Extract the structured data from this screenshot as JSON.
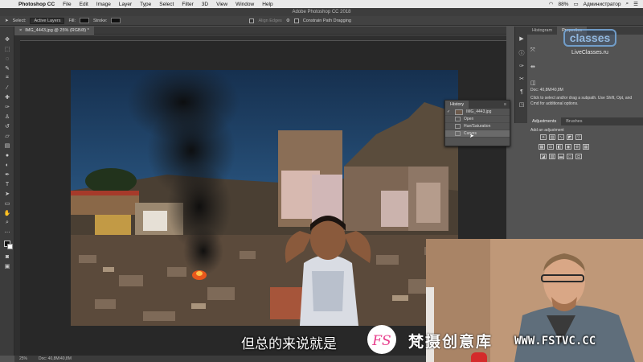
{
  "menubar": {
    "app": "Photoshop CC",
    "items": [
      "File",
      "Edit",
      "Image",
      "Layer",
      "Type",
      "Select",
      "Filter",
      "3D",
      "View",
      "Window",
      "Help"
    ],
    "battery": "88%",
    "user": "Администратор"
  },
  "window_title": "Adobe Photoshop CC 2018",
  "options": {
    "select_label": "Select:",
    "select_value": "Active Layers",
    "fill_label": "Fill:",
    "stroke_label": "Stroke:",
    "align_edges": "Align Edges",
    "constrain": "Constrain Path Dragging"
  },
  "document": {
    "tab": "IMG_4443.jpg @ 25% (RGB/8) *",
    "zoom": "25%",
    "doc_size": "Doc: 40,8M/40,8M"
  },
  "right_panel": {
    "tabs": [
      "Histogram",
      "Properties"
    ],
    "doc_info": "Doc: 40,8M/40,8M",
    "help_text": "Click to select and/or drag a subpath. Use Shift, Opt, and Cmd for additional options.",
    "adj_tabs": [
      "Adjustments",
      "Brushes"
    ],
    "add_adjustment": "Add an adjustment"
  },
  "history": {
    "title": "History",
    "items": [
      {
        "label": "IMG_4443.jpg",
        "kind": "snapshot"
      },
      {
        "label": "Open",
        "kind": "step"
      },
      {
        "label": "Hue/Saturation",
        "kind": "step"
      },
      {
        "label": "Curves",
        "kind": "step",
        "selected": true
      }
    ]
  },
  "watermark": {
    "logo": "classes",
    "url": "LiveClasses.ru"
  },
  "overlay": {
    "subtitle": "但总的来说就是",
    "brand": "梵摄创意库",
    "brand_url": "WWW.FSTVC.CC",
    "logo_letters": "FS"
  },
  "colors": {
    "ps_dark": "#3c3c3c",
    "ps_mid": "#535353",
    "sky": "#1e3d63",
    "brand_pink": "#e83e8c"
  }
}
